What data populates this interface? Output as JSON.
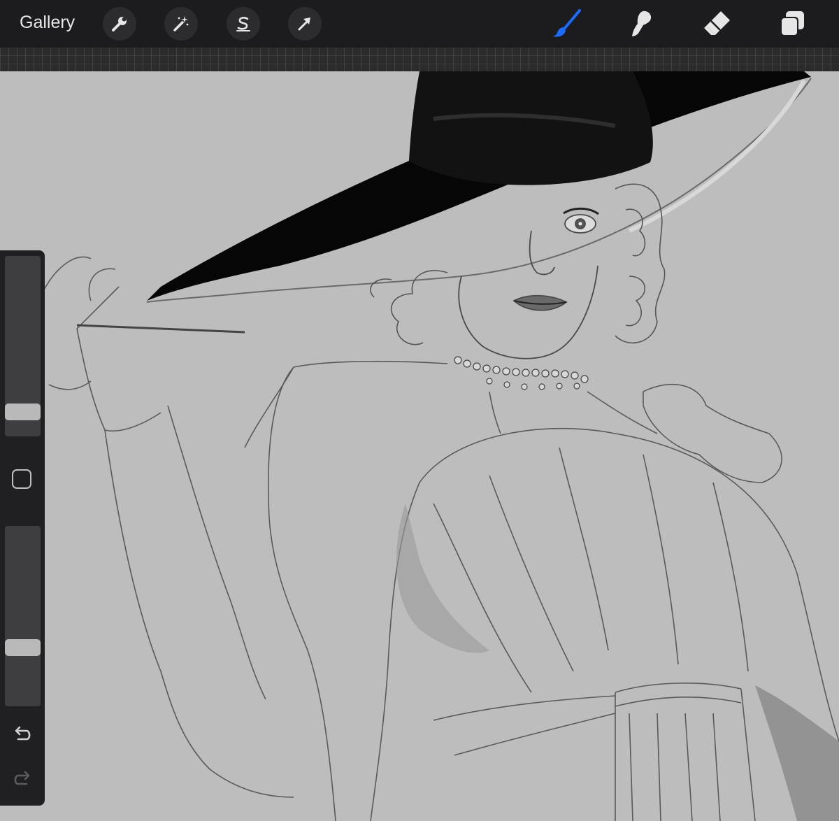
{
  "toolbar": {
    "gallery_label": "Gallery",
    "left_tools": [
      {
        "name": "actions",
        "icon": "wrench-icon"
      },
      {
        "name": "adjustments",
        "icon": "magic-wand-icon"
      },
      {
        "name": "selection",
        "icon": "selection-s-icon"
      },
      {
        "name": "transform",
        "icon": "arrow-cursor-icon"
      }
    ],
    "right_tools": [
      {
        "name": "brush",
        "icon": "brush-icon",
        "active": true
      },
      {
        "name": "smudge",
        "icon": "smudge-icon",
        "active": false
      },
      {
        "name": "eraser",
        "icon": "eraser-icon",
        "active": false
      },
      {
        "name": "layers",
        "icon": "layers-icon",
        "active": false
      }
    ],
    "active_color": "#1a6cff",
    "icon_color": "#e6e6e6"
  },
  "sidebar": {
    "brush_size": 0.18,
    "opacity": 0.22,
    "undo_icon": "undo-icon",
    "redo_icon": "redo-icon",
    "modify_icon": "square-modify-icon"
  },
  "canvas": {
    "background": "#bdbdbd",
    "artwork": "pencil-sketch-woman-in-wide-black-hat"
  }
}
